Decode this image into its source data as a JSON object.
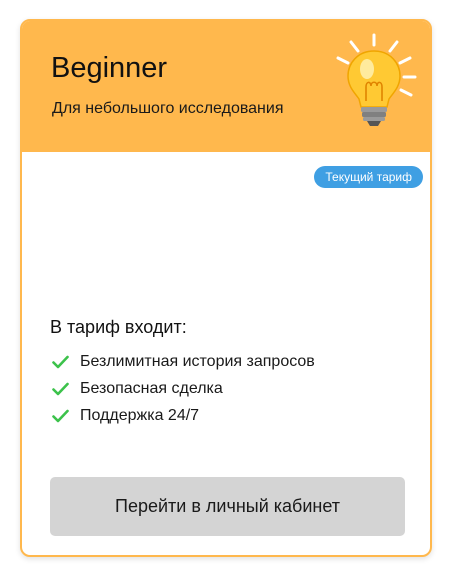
{
  "plan": {
    "title": "Beginner",
    "subtitle": "Для небольшого исследования",
    "illustration": "lightbulb-icon",
    "current_badge": "Текущий тариф"
  },
  "includes": {
    "title": "В тариф входит:",
    "items": [
      {
        "label": "Безлимитная история запросов",
        "icon": "check-icon"
      },
      {
        "label": "Безопасная сделка",
        "icon": "check-icon"
      },
      {
        "label": "Поддержка 24/7",
        "icon": "check-icon"
      }
    ]
  },
  "action": {
    "label": "Перейти в личный кабинет"
  },
  "colors": {
    "header": "#ffb84d",
    "border": "#ffb84d",
    "badge": "#3f9fe3",
    "check": "#3cc24b",
    "button": "#d4d4d4"
  }
}
